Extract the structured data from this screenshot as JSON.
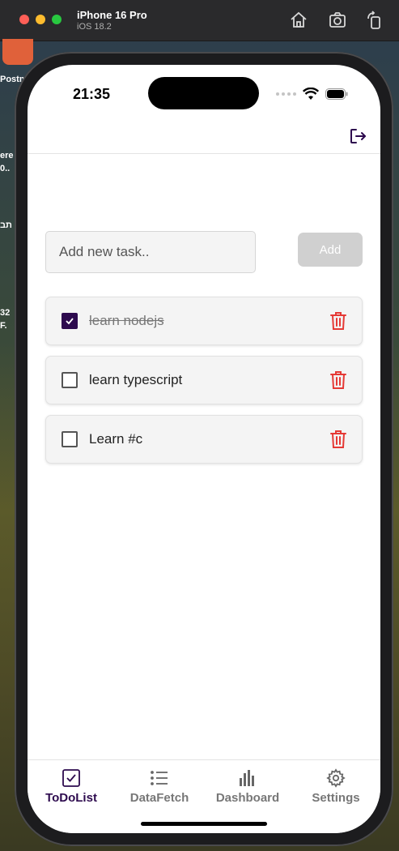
{
  "simulator": {
    "device_name": "iPhone 16 Pro",
    "os_version": "iOS 18.2"
  },
  "desktop": {
    "labels": [
      "Postm",
      "ere",
      "0..",
      "תב",
      "32",
      "F."
    ]
  },
  "status_bar": {
    "time": "21:35"
  },
  "add_task": {
    "placeholder": "Add new task..",
    "button_label": "Add"
  },
  "tasks": [
    {
      "text": "learn nodejs",
      "completed": true
    },
    {
      "text": "learn typescript",
      "completed": false
    },
    {
      "text": "Learn #c",
      "completed": false
    }
  ],
  "tabs": [
    {
      "label": "ToDoList",
      "icon": "checkbox-icon",
      "active": true
    },
    {
      "label": "DataFetch",
      "icon": "list-icon",
      "active": false
    },
    {
      "label": "Dashboard",
      "icon": "bar-chart-icon",
      "active": false
    },
    {
      "label": "Settings",
      "icon": "gear-icon",
      "active": false
    }
  ],
  "colors": {
    "accent": "#2d0a4e",
    "delete": "#e53935",
    "add_button_disabled": "#d0d0d0"
  }
}
